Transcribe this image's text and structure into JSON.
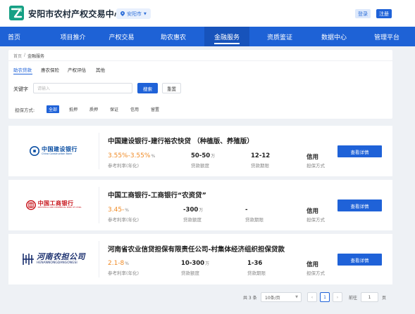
{
  "header": {
    "site_title": "安阳市农村产权交易中心",
    "region": "安阳市",
    "login": "登录",
    "register": "注册",
    "brand_color": "#1e62d6"
  },
  "nav": {
    "items": [
      "首页",
      "项目推介",
      "产权交易",
      "助农惠农",
      "金融服务",
      "资质鉴证",
      "数据中心",
      "管理平台"
    ],
    "active_index": 4
  },
  "breadcrumb": {
    "home": "首页",
    "separator": "/",
    "current": "金融服务"
  },
  "subtabs": {
    "items": [
      "助农贷款",
      "惠农保险",
      "产权评估",
      "其他"
    ],
    "active_index": 0
  },
  "search": {
    "label": "关键字",
    "placeholder": "请输入",
    "search_button": "搜索",
    "reset_button": "重置"
  },
  "guarantee": {
    "label": "担保方式:",
    "options": [
      "全部",
      "抵押",
      "质押",
      "保证",
      "信用",
      "留置"
    ],
    "active_index": 0
  },
  "products": [
    {
      "logo_name": "中国建设银行",
      "logo_sub": "China Construction Bank",
      "title": "中国建设银行-建行裕农快贷 （种植版、养殖版）",
      "rate": "3.55%-3.55%",
      "rate_unit": "%",
      "rate_label": "参考利率(年化)",
      "amount": "50-50",
      "amount_unit": "万",
      "amount_label": "贷款额度",
      "term": "12-12",
      "term_label": "贷款期限",
      "guarantee": "信用",
      "guarantee_label": "担保方式",
      "button": "查看详情"
    },
    {
      "logo_name": "中国工商银行",
      "logo_sub": "INDUSTRIAL AND COMMERCIAL BANK OF CHINA",
      "title": "中国工商银行-工商银行“农资贷”",
      "rate": "3.45-",
      "rate_unit": "%",
      "rate_label": "参考利率(年化)",
      "amount": "-300",
      "amount_unit": "万",
      "amount_label": "贷款额度",
      "term": "-",
      "term_label": "贷款期限",
      "guarantee": "信用",
      "guarantee_label": "担保方式",
      "button": "查看详情"
    },
    {
      "logo_name": "河南农担公司",
      "logo_sub": "HENANNONGDANGONGSI",
      "title": "河南省农业信贷担保有限责任公司-村集体经济组织担保贷款",
      "rate": "2.1-8",
      "rate_unit": "%",
      "rate_label": "参考利率(年化)",
      "amount": "10-300",
      "amount_unit": "万",
      "amount_label": "贷款额度",
      "term": "1-36",
      "term_label": "贷款期限",
      "guarantee": "信用",
      "guarantee_label": "担保方式",
      "button": "查看详情"
    }
  ],
  "pagination": {
    "total": "共 3 条",
    "page_size": "10条/页",
    "prev": "‹",
    "current": "1",
    "next": "›",
    "goto_label": "前往",
    "goto_value": "1",
    "page_suffix": "页"
  }
}
